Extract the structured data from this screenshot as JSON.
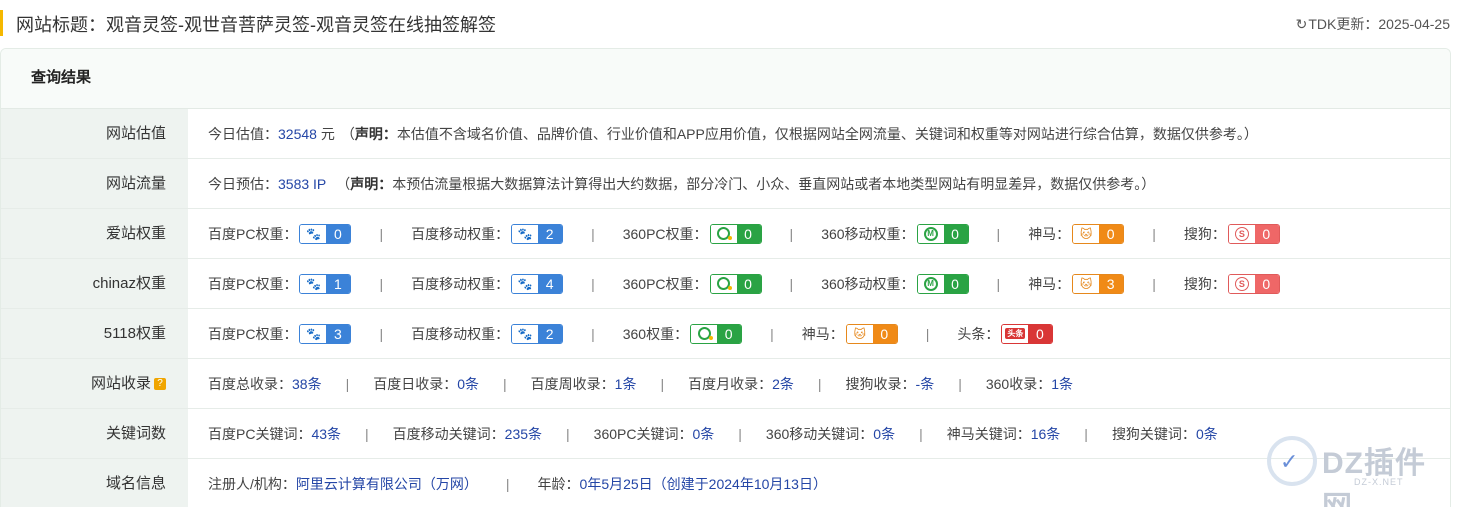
{
  "header": {
    "title": "网站标题：观音灵签-观世音菩萨灵签-观音灵签在线抽签解签",
    "tdk_label": "TDK更新：",
    "tdk_date": "2025-04-25"
  },
  "panel": {
    "title": "查询结果"
  },
  "valuation": {
    "label": "网站估值",
    "prefix": "今日估值：",
    "value": "32548",
    "unit": "元",
    "decl_open": "（",
    "decl_label": "声明：",
    "decl_text": "本估值不含域名价值、品牌价值、行业价值和APP应用价值，仅根据网站全网流量、关键词和权重等对网站进行综合估算，数据仅供参考。）"
  },
  "traffic": {
    "label": "网站流量",
    "prefix": "今日预估：",
    "value": "3583 IP",
    "decl_open": "（",
    "decl_label": "声明：",
    "decl_text": "本预估流量根据大数据算法计算得出大约数据，部分冷门、小众、垂直网站或者本地类型网站有明显差异，数据仅供参考。）"
  },
  "aizhan": {
    "label": "爱站权重",
    "items": [
      {
        "name": "百度PC权重：",
        "value": "0",
        "type": "baidu"
      },
      {
        "name": "百度移动权重：",
        "value": "2",
        "type": "baidu"
      },
      {
        "name": "360PC权重：",
        "value": "0",
        "type": "360"
      },
      {
        "name": "360移动权重：",
        "value": "0",
        "type": "360m"
      },
      {
        "name": "神马：",
        "value": "0",
        "type": "sm"
      },
      {
        "name": "搜狗：",
        "value": "0",
        "type": "sg"
      }
    ]
  },
  "chinaz": {
    "label": "chinaz权重",
    "items": [
      {
        "name": "百度PC权重：",
        "value": "1",
        "type": "baidu"
      },
      {
        "name": "百度移动权重：",
        "value": "4",
        "type": "baidu"
      },
      {
        "name": "360PC权重：",
        "value": "0",
        "type": "360"
      },
      {
        "name": "360移动权重：",
        "value": "0",
        "type": "360m"
      },
      {
        "name": "神马：",
        "value": "3",
        "type": "sm"
      },
      {
        "name": "搜狗：",
        "value": "0",
        "type": "sg"
      }
    ]
  },
  "w5118": {
    "label": "5118权重",
    "items": [
      {
        "name": "百度PC权重：",
        "value": "3",
        "type": "baidu"
      },
      {
        "name": "百度移动权重：",
        "value": "2",
        "type": "baidu"
      },
      {
        "name": "360权重：",
        "value": "0",
        "type": "360"
      },
      {
        "name": "神马：",
        "value": "0",
        "type": "sm"
      },
      {
        "name": "头条：",
        "value": "0",
        "type": "tt"
      }
    ]
  },
  "indexing": {
    "label": "网站收录",
    "help": "?",
    "items": [
      {
        "name": "百度总收录：",
        "value": "38条"
      },
      {
        "name": "百度日收录：",
        "value": "0条"
      },
      {
        "name": "百度周收录：",
        "value": "1条"
      },
      {
        "name": "百度月收录：",
        "value": "2条"
      },
      {
        "name": "搜狗收录：",
        "value": "-条"
      },
      {
        "name": "360收录：",
        "value": "1条"
      }
    ]
  },
  "keywords": {
    "label": "关键词数",
    "items": [
      {
        "name": "百度PC关键词：",
        "value": "43条"
      },
      {
        "name": "百度移动关键词：",
        "value": "235条"
      },
      {
        "name": "360PC关键词：",
        "value": "0条"
      },
      {
        "name": "360移动关键词：",
        "value": "0条"
      },
      {
        "name": "神马关键词：",
        "value": "16条"
      },
      {
        "name": "搜狗关键词：",
        "value": "0条"
      }
    ]
  },
  "domain": {
    "label": "域名信息",
    "registrant_label": "注册人/机构：",
    "registrant": "阿里云计算有限公司（万网）",
    "age_label": "年龄：",
    "age": "0年5月25日（创建于2024年10月13日）"
  },
  "watermark": {
    "text": "DZ插件网",
    "sub": "DZ-X.NET"
  }
}
